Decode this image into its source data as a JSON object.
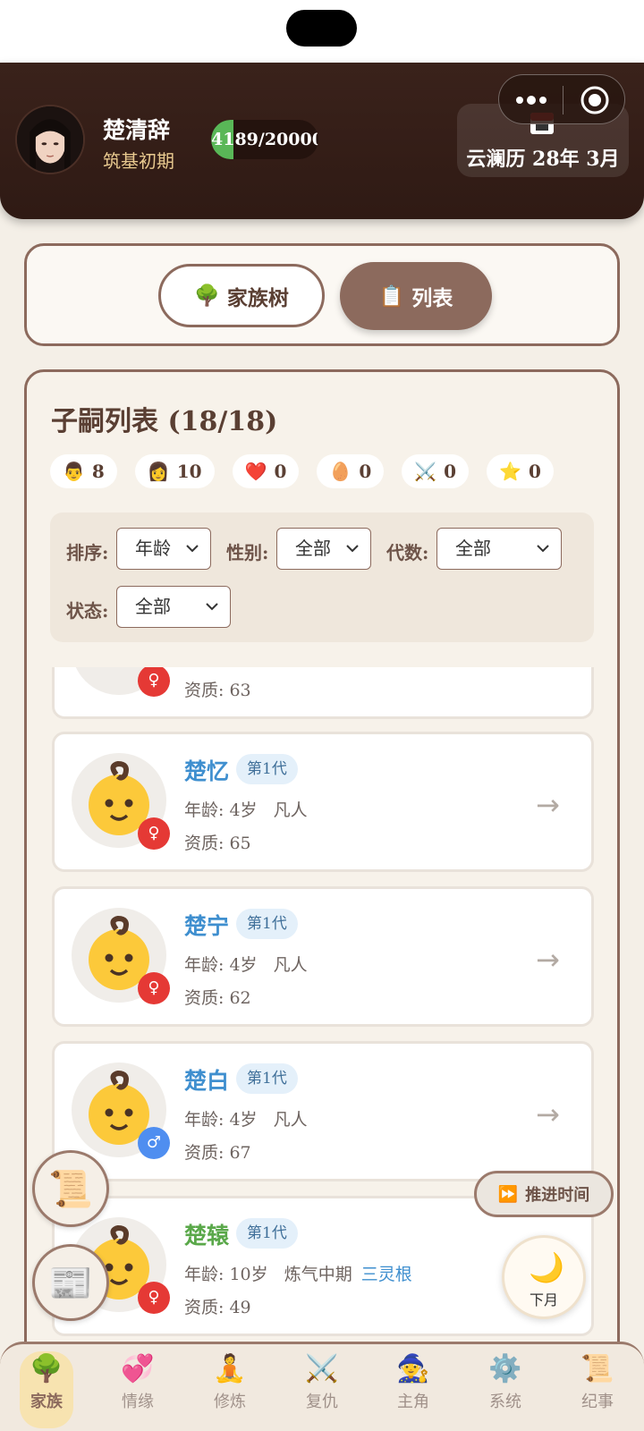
{
  "header": {
    "player_name": "楚清辞",
    "realm": "筑基初期",
    "exp_text": "4189/20000",
    "exp_progress": 0.2095,
    "calendar_icon": "calendar-icon",
    "date_text": "云澜历 28年 3月"
  },
  "view_toggle": {
    "tree_icon": "🌳",
    "tree_label": "家族树",
    "list_icon": "📋",
    "list_label": "列表"
  },
  "list": {
    "title": "子嗣列表 (18/18)",
    "stats": [
      {
        "icon": "👨",
        "value": "8"
      },
      {
        "icon": "👩",
        "value": "10"
      },
      {
        "icon": "❤️",
        "value": "0"
      },
      {
        "icon": "🥚",
        "value": "0"
      },
      {
        "icon": "⚔️",
        "value": "0"
      },
      {
        "icon": "⭐",
        "value": "0"
      }
    ],
    "filters": {
      "sort_label": "排序:",
      "sort_value": "年龄",
      "gender_label": "性别:",
      "gender_value": "全部",
      "generation_label": "代数:",
      "generation_value": "全部",
      "status_label": "状态:",
      "status_value": "全部"
    },
    "partial_card": {
      "aptitude": "资质: 63",
      "gender": "♀"
    },
    "children": [
      {
        "name": "楚忆",
        "generation": "第1代",
        "age": "年龄: 4岁",
        "realm": "凡人",
        "root": "",
        "aptitude": "资质: 65",
        "gender": "♀",
        "name_color": "blue"
      },
      {
        "name": "楚宁",
        "generation": "第1代",
        "age": "年龄: 4岁",
        "realm": "凡人",
        "root": "",
        "aptitude": "资质: 62",
        "gender": "♀",
        "name_color": "blue"
      },
      {
        "name": "楚白",
        "generation": "第1代",
        "age": "年龄: 4岁",
        "realm": "凡人",
        "root": "",
        "aptitude": "资质: 67",
        "gender": "♂",
        "name_color": "blue"
      },
      {
        "name": "楚辕",
        "generation": "第1代",
        "age": "年龄: 10岁",
        "realm": "炼气中期",
        "root": "三灵根",
        "aptitude": "资质: 49",
        "gender": "♀",
        "name_color": "green"
      }
    ],
    "arrow": "→"
  },
  "floating": {
    "scroll_icon": "📜",
    "newspaper_icon": "📰",
    "advance_icon": "⏩",
    "advance_label": "推进时间",
    "next_month_icon": "🌙",
    "next_month_label": "下月"
  },
  "tabbar": {
    "tabs": [
      {
        "icon": "🌳",
        "label": "家族",
        "active": true
      },
      {
        "icon": "💞",
        "label": "情缘",
        "active": false
      },
      {
        "icon": "🧘",
        "label": "修炼",
        "active": false
      },
      {
        "icon": "⚔️",
        "label": "复仇",
        "active": false
      },
      {
        "icon": "🧙",
        "label": "主角",
        "active": false
      },
      {
        "icon": "⚙️",
        "label": "系统",
        "active": false
      },
      {
        "icon": "📜",
        "label": "纪事",
        "active": false
      }
    ]
  },
  "colors": {
    "header_bg": "#3a221b",
    "accent": "#8c6a5d",
    "exp_green": "#59b757",
    "female_badge": "#e53935",
    "male_badge": "#4f8ef0",
    "name_blue": "#3f8fcf",
    "name_green": "#5aa84a"
  }
}
